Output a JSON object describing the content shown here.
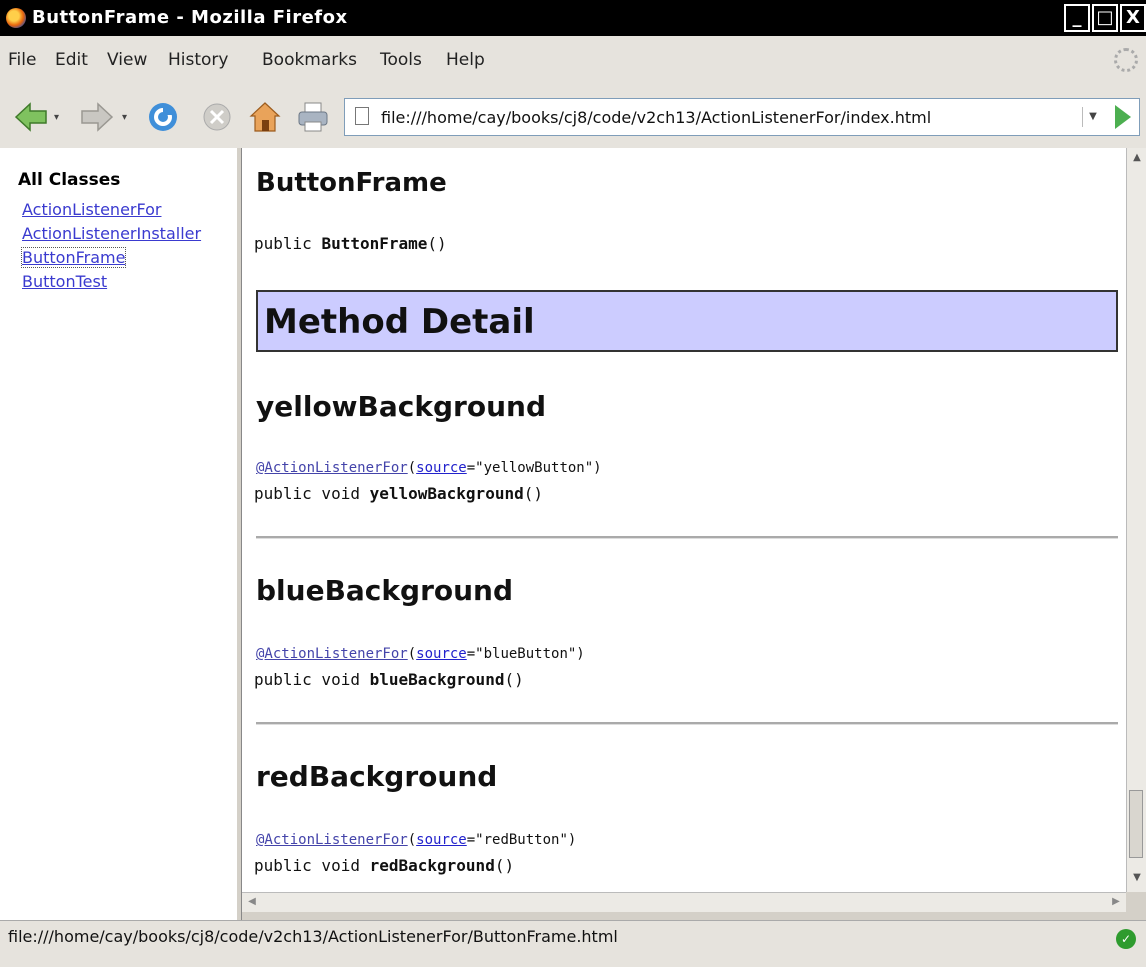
{
  "window": {
    "title": "ButtonFrame - Mozilla Firefox",
    "controls": [
      "_",
      "□",
      "X"
    ]
  },
  "menu": {
    "items": [
      "File",
      "Edit",
      "View",
      "History",
      "Bookmarks",
      "Tools",
      "Help"
    ]
  },
  "toolbar": {
    "url": "file:///home/cay/books/cj8/code/v2ch13/ActionListenerFor/index.html",
    "icons": [
      "back-arrow-icon",
      "forward-arrow-icon",
      "reload-icon",
      "stop-icon",
      "home-icon",
      "print-icon",
      "page-icon",
      "url-dropdown-icon",
      "go-icon"
    ]
  },
  "sidebar": {
    "heading": "All Classes",
    "classes": [
      "ActionListenerFor",
      "ActionListenerInstaller",
      "ButtonFrame",
      "ButtonTest"
    ]
  },
  "content": {
    "constructor_heading": "ButtonFrame",
    "constructor_sig": {
      "prefix": "public ",
      "name": "ButtonFrame",
      "suffix": "()"
    },
    "method_detail_heading": "Method Detail",
    "methods": [
      {
        "name": "yellowBackground",
        "anno_name": "@ActionListenerFor",
        "anno_open": "(",
        "anno_key": "source",
        "anno_value": "=\"yellowButton\")",
        "sig_prefix": "public void ",
        "sig_name": "yellowBackground",
        "sig_suffix": "()"
      },
      {
        "name": "blueBackground",
        "anno_name": "@ActionListenerFor",
        "anno_open": "(",
        "anno_key": "source",
        "anno_value": "=\"blueButton\")",
        "sig_prefix": "public void ",
        "sig_name": "blueBackground",
        "sig_suffix": "()"
      },
      {
        "name": "redBackground",
        "anno_name": "@ActionListenerFor",
        "anno_open": "(",
        "anno_key": "source",
        "anno_value": "=\"redButton\")",
        "sig_prefix": "public void ",
        "sig_name": "redBackground",
        "sig_suffix": "()"
      }
    ]
  },
  "status": {
    "text": "file:///home/cay/books/cj8/code/v2ch13/ActionListenerFor/ButtonFrame.html",
    "security_icon": "check-icon"
  },
  "colors": {
    "method_header_bg": "#ccccff",
    "link": "#3a3acf"
  }
}
